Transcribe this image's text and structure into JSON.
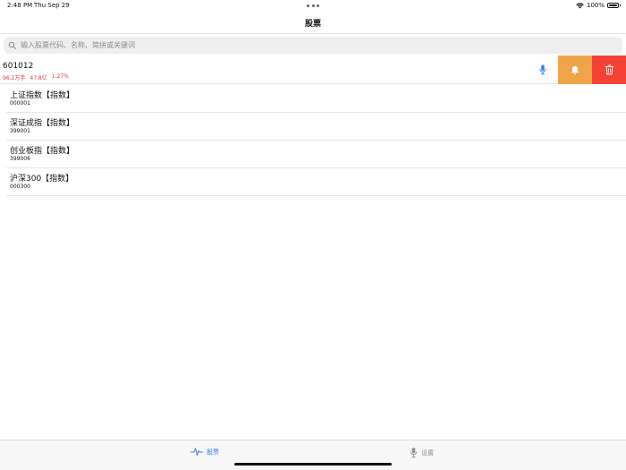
{
  "status_bar": {
    "time": "2:48 PM",
    "date": "Thu Sep 29",
    "battery": "100%"
  },
  "nav": {
    "title": "股票"
  },
  "search": {
    "placeholder": "输入股票代码、名称、简拼或关键词",
    "value": ""
  },
  "stock": {
    "code": "601012",
    "volume": "96.2万手",
    "amount": "47.8亿",
    "change": "1.27%",
    "stats_color": "#e53935",
    "actions": {
      "mic_icon": "mic-icon",
      "bell_icon": "bell-icon",
      "trash_icon": "trash-icon",
      "bell_color": "#f0a44a",
      "trash_color": "#f44336"
    }
  },
  "indices": [
    {
      "name": "上证指数【指数】",
      "code": "000001"
    },
    {
      "name": "深证成指【指数】",
      "code": "399001"
    },
    {
      "name": "创业板指【指数】",
      "code": "399006"
    },
    {
      "name": "沪深300【指数】",
      "code": "000300"
    }
  ],
  "tabs": [
    {
      "label": "股票",
      "icon": "pulse-icon",
      "active": true
    },
    {
      "label": "设置",
      "icon": "mic-icon",
      "active": false
    }
  ],
  "colors": {
    "accent": "#2f80ed",
    "inactive": "#8e8e93"
  }
}
